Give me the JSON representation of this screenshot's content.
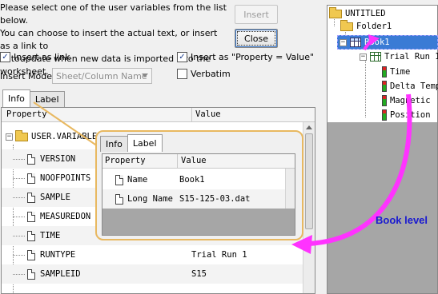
{
  "instructions": "Please select one of the user variables from the list below.\nYou can choose to insert the actual text, or insert as a link to\nautoupdate when new data is imported into the worksheet.",
  "buttons": {
    "insert": "Insert",
    "close": "Close"
  },
  "options": {
    "insert_as_link": {
      "label": "Insert as link",
      "checked": true
    },
    "insert_as_property": {
      "label": "Insert as \"Property = Value\"",
      "checked": true
    },
    "verbatim": {
      "label": "Verbatim",
      "checked": false
    },
    "insert_mode_label": "Insert Mode",
    "insert_mode_value": "Sheet/Column Name"
  },
  "tabs": [
    "Info",
    "Label"
  ],
  "grid": {
    "columns": [
      "Property",
      "Value"
    ],
    "folder": "USER.VARIABLES",
    "rows": [
      {
        "property": "VERSION",
        "value": ""
      },
      {
        "property": "NOOFPOINTS",
        "value": ""
      },
      {
        "property": "SAMPLE",
        "value": ""
      },
      {
        "property": "MEASUREDON",
        "value": ""
      },
      {
        "property": "TIME",
        "value": ""
      },
      {
        "property": "RUNTYPE",
        "value": "Trial Run 1"
      },
      {
        "property": "SAMPLEID",
        "value": "S15"
      }
    ]
  },
  "popup": {
    "tabs": [
      "Info",
      "Label"
    ],
    "columns": [
      "Property",
      "Value"
    ],
    "rows": [
      {
        "property": "Name",
        "value": "Book1"
      },
      {
        "property": "Long Name",
        "value": "S15-125-03.dat"
      }
    ]
  },
  "project_tree": {
    "root": "UNTITLED",
    "folder": "Folder1",
    "book": "Book1",
    "sheet": "Trial Run 1",
    "columns": [
      "Time",
      "Delta Temp",
      "Magnetic",
      "Position"
    ]
  },
  "annotation": "Book level",
  "colors": {
    "selection": "#3a7bd5",
    "arrow": "#ff33ff",
    "annotation": "#1a1ad0",
    "callout": "#e8b860"
  }
}
